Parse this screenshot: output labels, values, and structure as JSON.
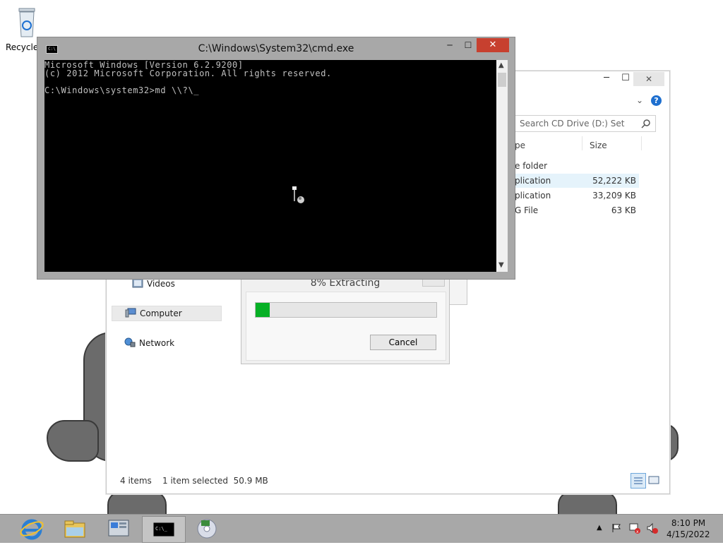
{
  "desktop": {
    "recycle_bin_label": "Recycle"
  },
  "explorer": {
    "search_placeholder": "Search CD Drive (D:) Set",
    "columns": {
      "type": "pe",
      "size": "Size"
    },
    "files": [
      {
        "type": "e folder",
        "size": ""
      },
      {
        "type": "plication",
        "size": "52,222 KB"
      },
      {
        "type": "plication",
        "size": "33,209 KB"
      },
      {
        "type": "G File",
        "size": "63 KB"
      }
    ],
    "nav": {
      "videos": "Videos",
      "computer": "Computer",
      "network": "Network"
    },
    "status": {
      "items": "4 items",
      "selected": "1 item selected  50.9 MB"
    }
  },
  "cmd": {
    "title": "C:\\Windows\\System32\\cmd.exe",
    "lines": [
      "Microsoft Windows [Version 6.2.9200]",
      "(c) 2012 Microsoft Corporation. All rights reserved.",
      "",
      "C:\\Windows\\system32>md \\\\?\\_"
    ]
  },
  "progress_dialog": {
    "title": "8% Extracting",
    "percent": 8,
    "cancel_label": "Cancel"
  },
  "taskbar": {
    "time": "8:10 PM",
    "date": "4/15/2022"
  },
  "colors": {
    "close_red": "#c7402f",
    "progress_green": "#06b025",
    "taskbar": "#a8a8a8",
    "help_blue": "#1e6fcf"
  },
  "icons": [
    "recycle-bin-icon",
    "ie-icon",
    "explorer-icon",
    "server-manager-icon",
    "cmd-icon",
    "setup-disc-icon",
    "flag-icon",
    "network-error-icon",
    "volume-muted-icon",
    "help-icon",
    "search-icon"
  ]
}
